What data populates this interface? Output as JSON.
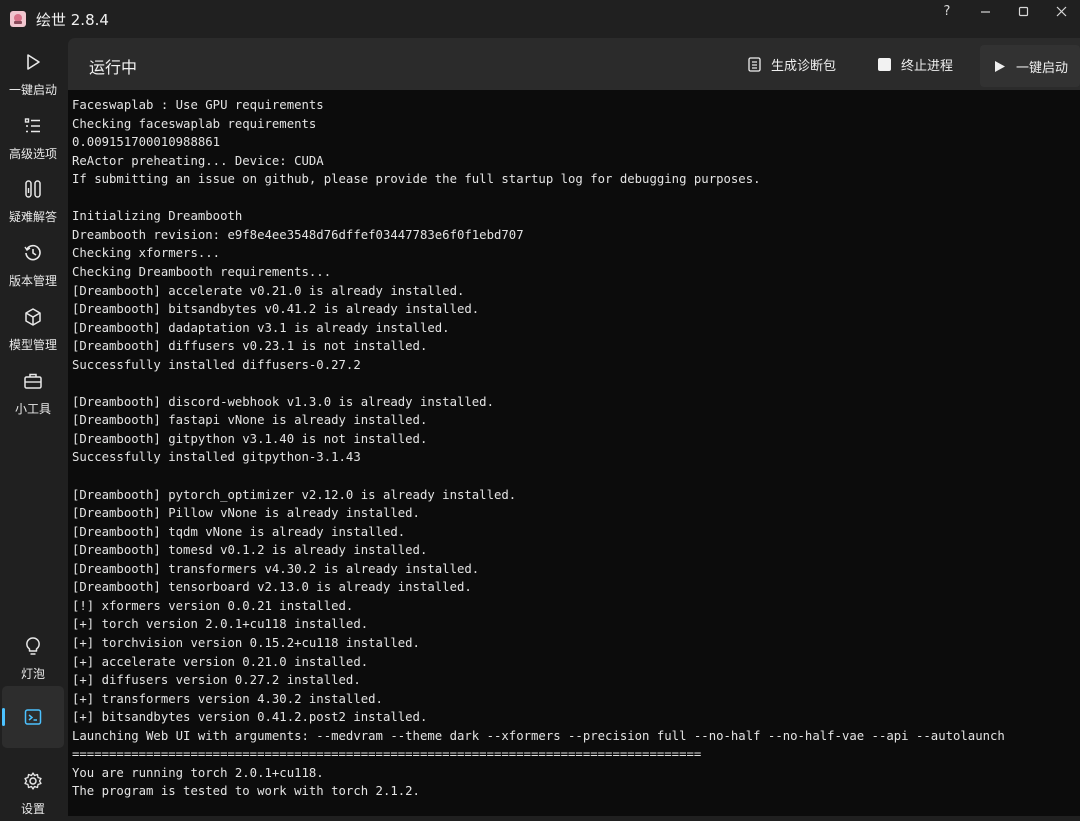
{
  "window": {
    "title": "绘世 2.8.4",
    "help_label": "?",
    "accent_color": "#4cc2ff"
  },
  "sidebar": {
    "items": [
      {
        "label": "一键启动",
        "icon": "play-icon"
      },
      {
        "label": "高级选项",
        "icon": "list-icon"
      },
      {
        "label": "疑难解答",
        "icon": "tools-icon"
      },
      {
        "label": "版本管理",
        "icon": "history-icon"
      },
      {
        "label": "模型管理",
        "icon": "cube-icon"
      },
      {
        "label": "小工具",
        "icon": "toolbox-icon"
      },
      {
        "label": "灯泡",
        "icon": "lightbulb-icon"
      },
      {
        "label": "",
        "icon": "terminal-icon"
      },
      {
        "label": "设置",
        "icon": "gear-icon"
      }
    ]
  },
  "header": {
    "title": "运行中",
    "diag_label": "生成诊断包",
    "stop_label": "终止进程",
    "launch_label": "一键启动"
  },
  "console": {
    "lines": [
      "Faceswaplab : Use GPU requirements",
      "Checking faceswaplab requirements",
      "0.009151700010988861",
      "ReActor preheating... Device: CUDA",
      "If submitting an issue on github, please provide the full startup log for debugging purposes.",
      "",
      "Initializing Dreambooth",
      "Dreambooth revision: e9f8e4ee3548d76dffef03447783e6f0f1ebd707",
      "Checking xformers...",
      "Checking Dreambooth requirements...",
      "[Dreambooth] accelerate v0.21.0 is already installed.",
      "[Dreambooth] bitsandbytes v0.41.2 is already installed.",
      "[Dreambooth] dadaptation v3.1 is already installed.",
      "[Dreambooth] diffusers v0.23.1 is not installed.",
      "Successfully installed diffusers-0.27.2",
      "",
      "[Dreambooth] discord-webhook v1.3.0 is already installed.",
      "[Dreambooth] fastapi vNone is already installed.",
      "[Dreambooth] gitpython v3.1.40 is not installed.",
      "Successfully installed gitpython-3.1.43",
      "",
      "[Dreambooth] pytorch_optimizer v2.12.0 is already installed.",
      "[Dreambooth] Pillow vNone is already installed.",
      "[Dreambooth] tqdm vNone is already installed.",
      "[Dreambooth] tomesd v0.1.2 is already installed.",
      "[Dreambooth] transformers v4.30.2 is already installed.",
      "[Dreambooth] tensorboard v2.13.0 is already installed.",
      "[!] xformers version 0.0.21 installed.",
      "[+] torch version 2.0.1+cu118 installed.",
      "[+] torchvision version 0.15.2+cu118 installed.",
      "[+] accelerate version 0.21.0 installed.",
      "[+] diffusers version 0.27.2 installed.",
      "[+] transformers version 4.30.2 installed.",
      "[+] bitsandbytes version 0.41.2.post2 installed.",
      "Launching Web UI with arguments: --medvram --theme dark --xformers --precision full --no-half --no-half-vae --api --autolaunch",
      "=====================================================================================",
      "You are running torch 2.0.1+cu118.",
      "The program is tested to work with torch 2.1.2."
    ]
  }
}
